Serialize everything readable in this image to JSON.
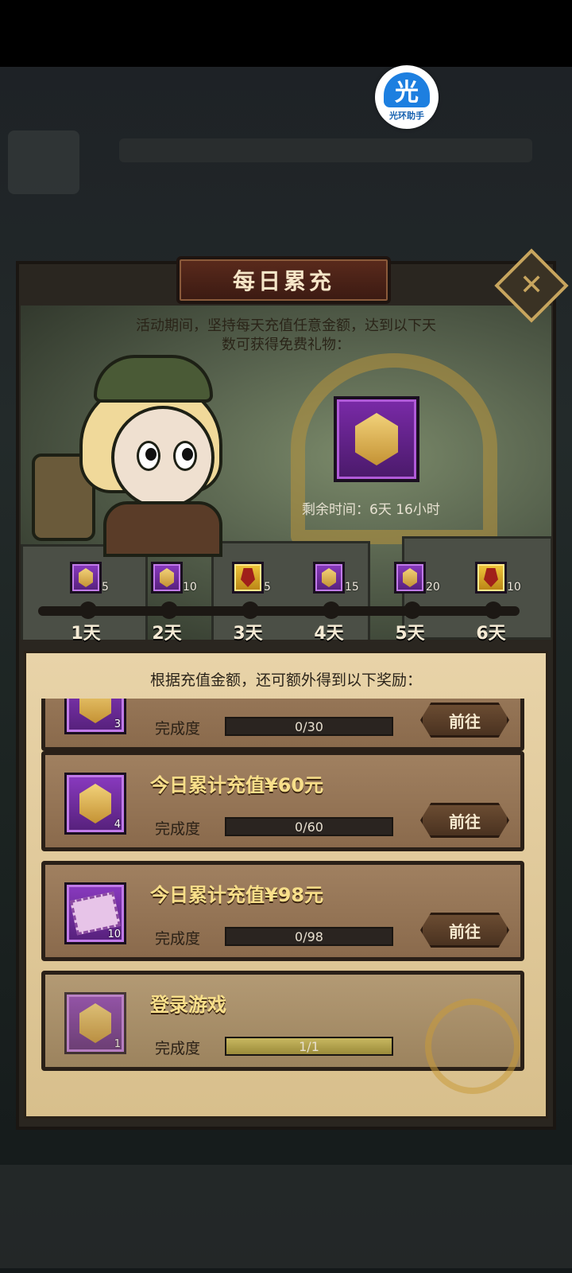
{
  "helper": {
    "glyph": "光",
    "caption": "光环助手"
  },
  "dialog": {
    "title": "每日累充",
    "close_icon": "✕",
    "description_line1": "活动期间，坚持每天充值任意金额，达到以下天",
    "description_line2": "数可获得免费礼物：",
    "remaining_time": "剩余时间：6天 16小时"
  },
  "days": [
    {
      "label": "1天",
      "qty": "5",
      "icon": "token-icon",
      "style": "purple"
    },
    {
      "label": "2天",
      "qty": "10",
      "icon": "token-icon",
      "style": "purple"
    },
    {
      "label": "3天",
      "qty": "5",
      "icon": "hero-card-icon",
      "style": "gold"
    },
    {
      "label": "4天",
      "qty": "15",
      "icon": "token-icon",
      "style": "purple"
    },
    {
      "label": "5天",
      "qty": "20",
      "icon": "token-icon",
      "style": "purple"
    },
    {
      "label": "6天",
      "qty": "10",
      "icon": "hero-card-icon",
      "style": "gold"
    }
  ],
  "extra_header": "根据充值金额，还可额外得到以下奖励：",
  "tasks": [
    {
      "name": "",
      "qty": "3",
      "progress_label": "完成度",
      "progress_text": "0/30",
      "progress": 0,
      "button": "前往",
      "icon": "token-icon"
    },
    {
      "name": "今日累计充值¥60元",
      "qty": "4",
      "progress_label": "完成度",
      "progress_text": "0/60",
      "progress": 0,
      "button": "前往",
      "icon": "token-icon"
    },
    {
      "name": "今日累计充值¥98元",
      "qty": "10",
      "progress_label": "完成度",
      "progress_text": "0/98",
      "progress": 0,
      "button": "前往",
      "icon": "ticket-icon"
    },
    {
      "name": "登录游戏",
      "qty": "1",
      "progress_label": "完成度",
      "progress_text": "1/1",
      "progress": 1,
      "button": "",
      "icon": "token-icon"
    }
  ],
  "colors": {
    "accent_gold": "#c7a55e",
    "title_text": "#f6e6c8",
    "task_title": "#f8df8a"
  }
}
